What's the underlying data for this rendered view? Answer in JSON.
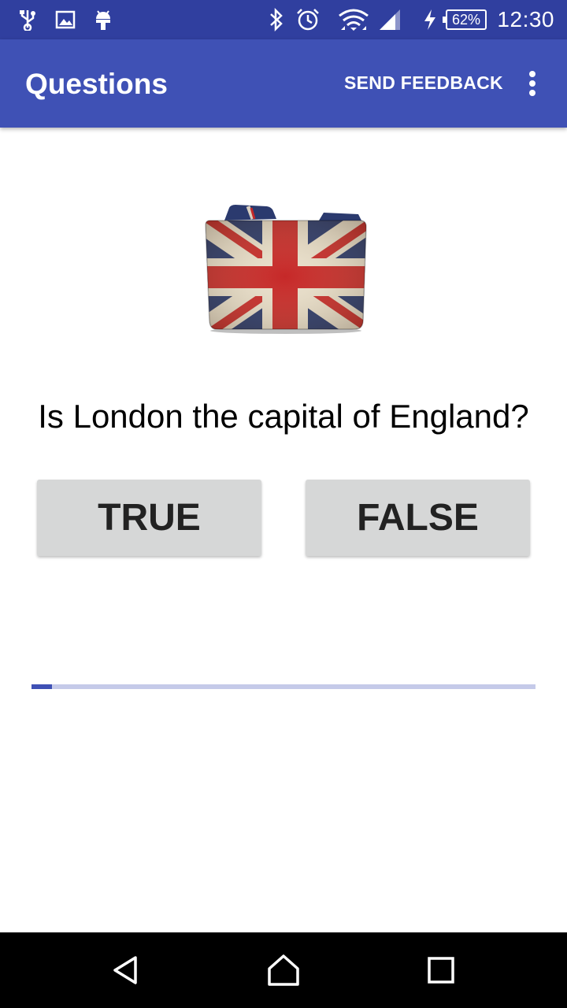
{
  "status_bar": {
    "time": "12:30",
    "battery": "62%",
    "icons": [
      "usb-icon",
      "image-icon",
      "android-icon",
      "bluetooth-icon",
      "alarm-icon",
      "wifi-icon",
      "signal-icon",
      "charging-icon"
    ]
  },
  "app_bar": {
    "title": "Questions",
    "feedback_label": "SEND FEEDBACK",
    "overflow_icon": "more-vert-icon"
  },
  "question": {
    "image": "union-jack-folder-icon",
    "text": "Is London the capital of England?"
  },
  "answers": {
    "true_label": "TRUE",
    "false_label": "FALSE"
  },
  "progress": {
    "value": 0.04
  },
  "colors": {
    "status_bar": "#303f9f",
    "app_bar": "#3f51b5",
    "progress_track": "#c5cae9",
    "progress_fill": "#3f51b5",
    "button": "#d6d7d7"
  },
  "nav_bar": {
    "icons": [
      "back-icon",
      "home-icon",
      "recents-icon"
    ]
  }
}
